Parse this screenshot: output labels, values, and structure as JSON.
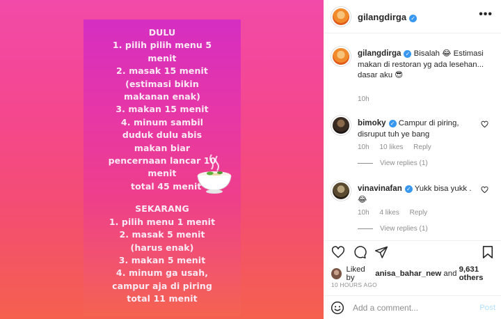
{
  "story": {
    "lines_top": [
      "DULU",
      "1. pilih pilih menu 5",
      "menit",
      "2. masak 15 menit",
      "(estimasi bikin",
      "makanan enak)",
      "3. makan 15 menit",
      "4. minum sambil",
      "duduk dulu abis",
      "makan biar",
      "pencernaan lancar 10",
      "menit",
      "total 45 menit"
    ],
    "lines_bottom": [
      "SEKARANG",
      "1. pilih menu 1 menit",
      "2. masak 5 menit",
      "(harus enak)",
      "3. makan 5 menit",
      "4. minum ga usah,",
      "campur aja di piring",
      "total 11 menit"
    ],
    "emoji_icon": "soup-bowl-icon"
  },
  "header": {
    "username": "gilangdirga",
    "more_label": "•••"
  },
  "caption": {
    "username": "gilangdirga",
    "text": "Bisalah 😂 Estimasi makan di restoran yg ada lesehan... dasar aku 😎",
    "time": "10h"
  },
  "comments": [
    {
      "username": "bimoky",
      "text": "Campur di piring, disruput tuh ye bang",
      "time": "10h",
      "likes": "10 likes",
      "reply": "Reply",
      "view_replies": "View replies (1)"
    },
    {
      "username": "vinavinafan",
      "text": "Yukk bisa yukk . 😂",
      "time": "10h",
      "likes": "4 likes",
      "reply": "Reply",
      "view_replies": "View replies (1)"
    }
  ],
  "footer": {
    "liked_prefix": "Liked by ",
    "liked_user": "anisa_bahar_new",
    "liked_and": " and ",
    "liked_others": "9,631 others",
    "post_time": "10 HOURS AGO",
    "comment_placeholder": "Add a comment...",
    "post_label": "Post"
  },
  "colors": {
    "verified": "#3897f0",
    "post_button": "#b2dffc",
    "muted": "#8e8e8e"
  }
}
